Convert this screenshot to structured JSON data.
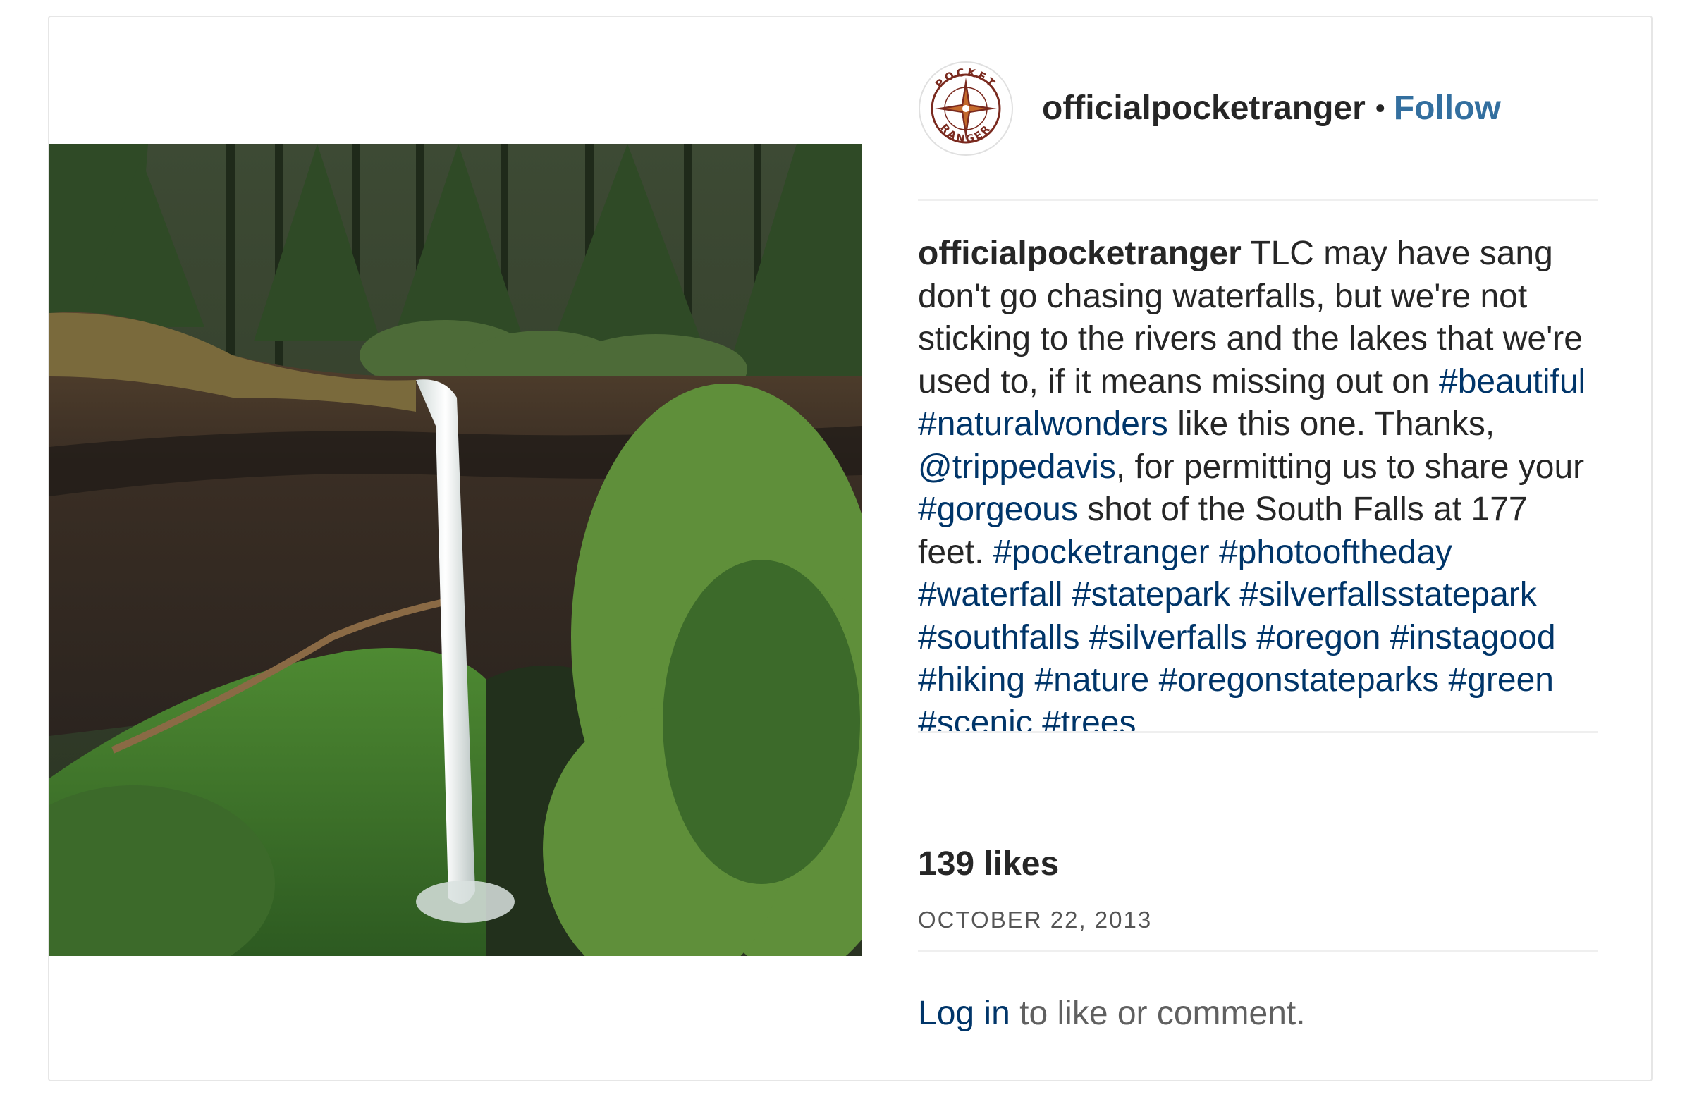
{
  "post": {
    "username": "officialpocketranger",
    "separator": "•",
    "follow_label": "Follow",
    "avatar_text": "POCKET RANGER",
    "caption": {
      "username": "officialpocketranger",
      "segments": [
        {
          "type": "text",
          "text": " TLC may have sang don't go chasing waterfalls, but we're not sticking to the rivers and the lakes that we're used to, if it means missing out on "
        },
        {
          "type": "tag",
          "text": "#beautiful"
        },
        {
          "type": "text",
          "text": " "
        },
        {
          "type": "tag",
          "text": "#naturalwonders"
        },
        {
          "type": "text",
          "text": " like this one. Thanks, "
        },
        {
          "type": "mention",
          "text": "@trippedavis"
        },
        {
          "type": "text",
          "text": ", for permitting us to share your "
        },
        {
          "type": "tag",
          "text": "#gorgeous"
        },
        {
          "type": "text",
          "text": " shot of the South Falls at 177 feet. "
        },
        {
          "type": "tag",
          "text": "#pocketranger"
        },
        {
          "type": "text",
          "text": " "
        },
        {
          "type": "tag",
          "text": "#photooftheday"
        },
        {
          "type": "text",
          "text": " "
        },
        {
          "type": "tag",
          "text": "#waterfall"
        },
        {
          "type": "text",
          "text": " "
        },
        {
          "type": "tag",
          "text": "#statepark"
        },
        {
          "type": "text",
          "text": " "
        },
        {
          "type": "tag",
          "text": "#silverfallsstatepark"
        },
        {
          "type": "text",
          "text": " "
        },
        {
          "type": "tag",
          "text": "#southfalls"
        },
        {
          "type": "text",
          "text": " "
        },
        {
          "type": "tag",
          "text": "#silverfalls"
        },
        {
          "type": "text",
          "text": " "
        },
        {
          "type": "tag",
          "text": "#oregon"
        },
        {
          "type": "text",
          "text": " "
        },
        {
          "type": "tag",
          "text": "#instagood"
        },
        {
          "type": "text",
          "text": " "
        },
        {
          "type": "tag",
          "text": "#hiking"
        },
        {
          "type": "text",
          "text": " "
        },
        {
          "type": "tag",
          "text": "#nature"
        },
        {
          "type": "text",
          "text": " "
        },
        {
          "type": "tag",
          "text": "#oregonstateparks"
        },
        {
          "type": "text",
          "text": " "
        },
        {
          "type": "tag",
          "text": "#green"
        },
        {
          "type": "text",
          "text": " "
        },
        {
          "type": "tag",
          "text": "#scenic"
        },
        {
          "type": "text",
          "text": " "
        },
        {
          "type": "tag",
          "text": "#trees"
        }
      ]
    },
    "likes": "139 likes",
    "date": "OCTOBER 22, 2013",
    "footer": {
      "login_label": "Log in",
      "rest_text": " to like or comment."
    }
  },
  "colors": {
    "link": "#003569",
    "follow": "#336f9f",
    "text": "#262626",
    "border": "#e6e6e6"
  }
}
